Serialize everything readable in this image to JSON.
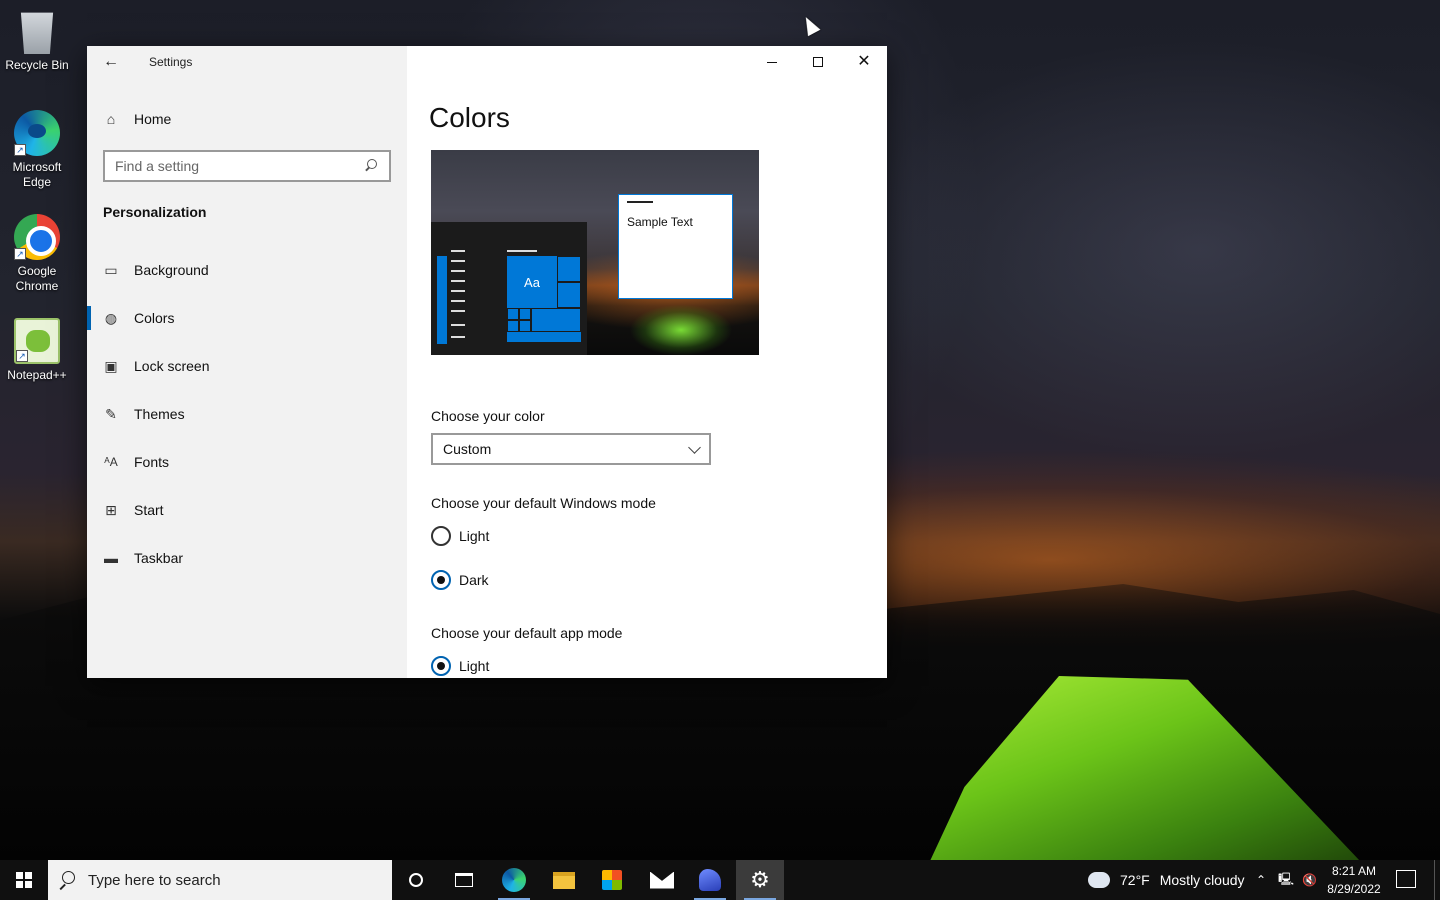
{
  "desktop": {
    "icons": [
      {
        "label": "Recycle Bin"
      },
      {
        "label": "Microsoft Edge"
      },
      {
        "label": "Google Chrome"
      },
      {
        "label": "Notepad++"
      }
    ]
  },
  "window": {
    "title": "Settings",
    "nav": {
      "home_label": "Home",
      "search_placeholder": "Find a setting",
      "section_title": "Personalization",
      "items": [
        {
          "label": "Background",
          "icon": "picture-icon"
        },
        {
          "label": "Colors",
          "icon": "palette-icon",
          "active": true
        },
        {
          "label": "Lock screen",
          "icon": "lock-screen-icon"
        },
        {
          "label": "Themes",
          "icon": "themes-icon"
        },
        {
          "label": "Fonts",
          "icon": "fonts-icon"
        },
        {
          "label": "Start",
          "icon": "start-icon"
        },
        {
          "label": "Taskbar",
          "icon": "taskbar-icon"
        }
      ]
    },
    "content": {
      "page_title": "Colors",
      "preview": {
        "tile_text": "Aa",
        "sample_text": "Sample Text"
      },
      "choose_color_label": "Choose your color",
      "choose_color_value": "Custom",
      "windows_mode_label": "Choose your default Windows mode",
      "windows_mode_options": [
        {
          "label": "Light",
          "selected": false
        },
        {
          "label": "Dark",
          "selected": true
        }
      ],
      "app_mode_label": "Choose your default app mode",
      "app_mode_options": [
        {
          "label": "Light",
          "selected": true
        }
      ]
    },
    "accent_color": "#0078d7"
  },
  "taskbar": {
    "search_placeholder": "Type here to search",
    "weather": {
      "temp": "72°F",
      "condition": "Mostly cloudy"
    },
    "clock": {
      "time": "8:21 AM",
      "date": "8/29/2022"
    }
  }
}
